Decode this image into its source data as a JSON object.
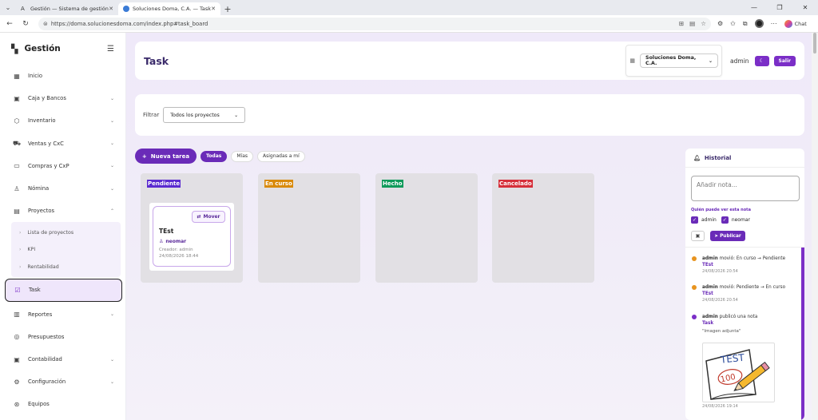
{
  "browser": {
    "tabs": [
      {
        "title": "Gestión — Sistema de gestión em",
        "active": false
      },
      {
        "title": "Soluciones Doma, C.A. — Task",
        "active": true
      }
    ],
    "url": "https://doma.solucionesdoma.com/index.php#task_board",
    "chat_label": "Chat"
  },
  "sidebar": {
    "brand": "Gestión",
    "items": [
      {
        "label": "Inicio",
        "icon": "grid-icon"
      },
      {
        "label": "Caja y Bancos",
        "icon": "cash-icon"
      },
      {
        "label": "Inventario",
        "icon": "box-icon"
      },
      {
        "label": "Ventas y CxC",
        "icon": "cart-icon"
      },
      {
        "label": "Compras y CxP",
        "icon": "purchase-icon"
      },
      {
        "label": "Nómina",
        "icon": "people-icon"
      },
      {
        "label": "Proyectos",
        "icon": "briefcase-icon"
      }
    ],
    "sub_items": [
      "Lista de proyectos",
      "KPI",
      "Rentabilidad"
    ],
    "active_item": "Task",
    "bottom_items": [
      {
        "label": "Reportes",
        "icon": "chart-icon"
      },
      {
        "label": "Presupuestos",
        "icon": "target-icon"
      },
      {
        "label": "Contabilidad",
        "icon": "ledger-icon"
      },
      {
        "label": "Configuración",
        "icon": "gear-icon"
      },
      {
        "label": "Equipos",
        "icon": "team-icon"
      }
    ]
  },
  "header": {
    "title": "Task",
    "company": "Soluciones Doma, C.A.",
    "user": "admin",
    "salir": "Salir"
  },
  "filter": {
    "label": "Filtrar",
    "value": "Todos los proyectos"
  },
  "toolbar": {
    "new_task": "Nueva tarea",
    "pills": [
      "Todas",
      "Mías",
      "Asignadas a mí"
    ],
    "active_pill": "Todas"
  },
  "board": {
    "columns": [
      {
        "title": "Pendiente",
        "color": "#5b2bd0"
      },
      {
        "title": "En curso",
        "color": "#d98a0b"
      },
      {
        "title": "Hecho",
        "color": "#0e9a5a"
      },
      {
        "title": "Cancelado",
        "color": "#d62f3a"
      }
    ],
    "task": {
      "move_label": "Mover",
      "name": "TEst",
      "assignee": "neomar",
      "creator": "Creador: admin",
      "date": "24/08/2026 18:44"
    }
  },
  "historial": {
    "title": "Historial",
    "placeholder": "Añadir nota...",
    "visibility_label": "Quién puede ver esta nota",
    "viewers": [
      "admin",
      "neomar"
    ],
    "publish": "Publicar",
    "entries": [
      {
        "who": "admin",
        "action": "movió: En curso → Pendiente",
        "link": "TEst",
        "time": "24/08/2026 20:54",
        "dot": "#e8941f"
      },
      {
        "who": "admin",
        "action": "movió: Pendiente → En curso",
        "link": "TEst",
        "time": "24/08/2026 20:54",
        "dot": "#e8941f"
      },
      {
        "who": "admin",
        "action": "publicó una nota",
        "link": "Task",
        "quote": "\"Imagen adjunta\"",
        "time": "24/08/2026 19:14",
        "dot": "#7b2ec7"
      }
    ],
    "image_text": [
      "TEST",
      "100"
    ]
  }
}
